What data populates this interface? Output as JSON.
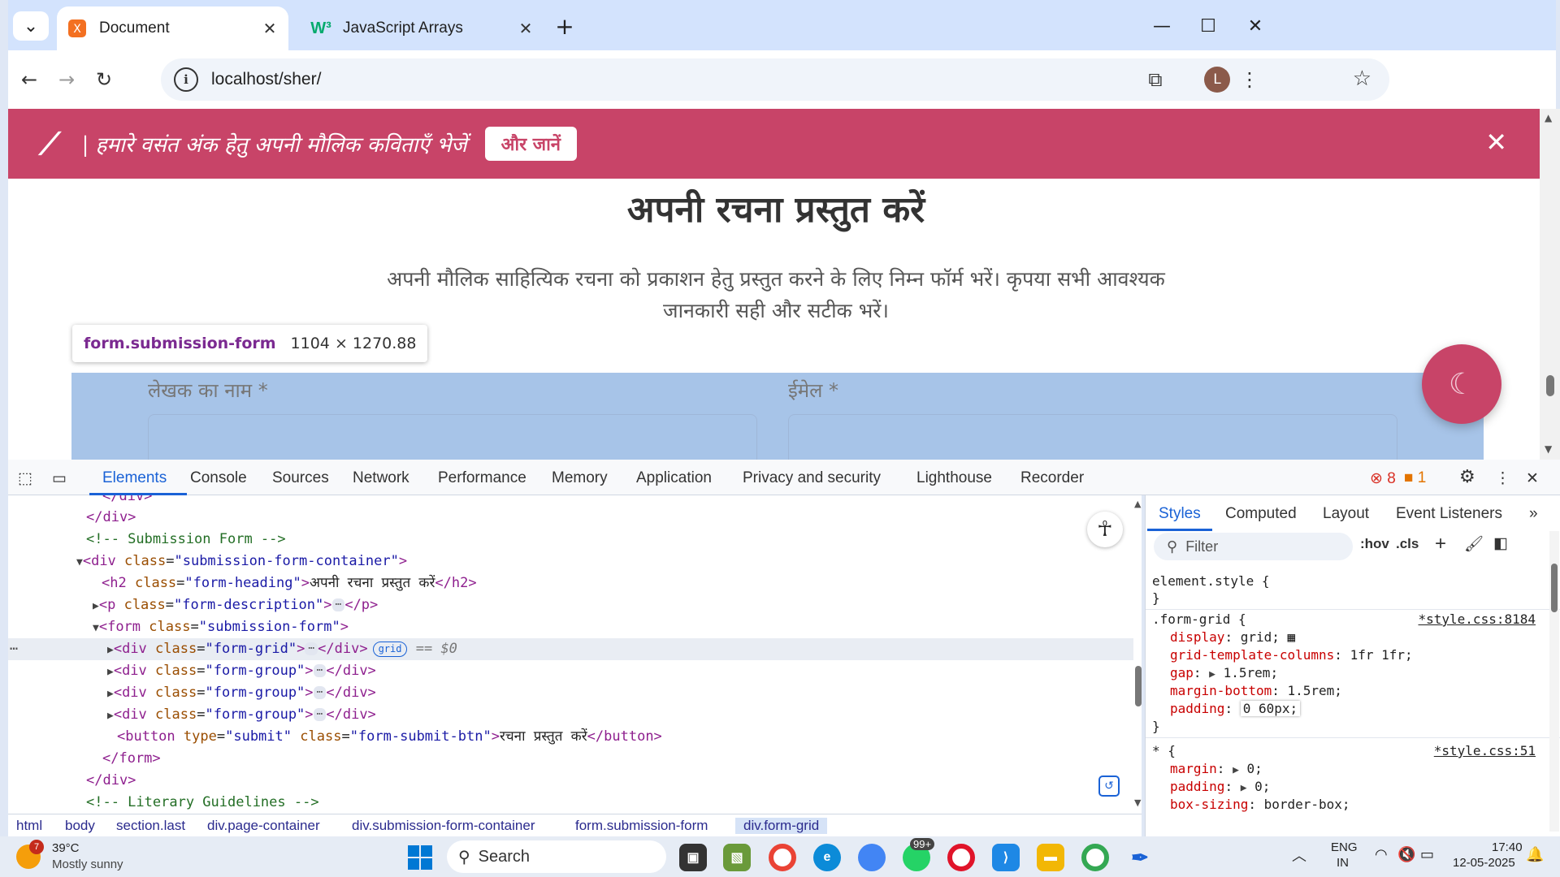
{
  "browser": {
    "tabs": [
      {
        "title": "Document",
        "close": "✕"
      },
      {
        "title": "JavaScript Arrays",
        "close": "✕"
      }
    ],
    "new_tab": "+",
    "url": "localhost/sher/",
    "profile_initial": "L"
  },
  "page": {
    "banner_text": "| हमारे वसंत अंक हेतु अपनी मौलिक कविताएँ भेजें",
    "banner_cta": "और जानें",
    "heading": "अपनी रचना प्रस्तुत करें",
    "description": "अपनी मौलिक साहित्यिक रचना को प्रकाशन हेतु प्रस्तुत करने के लिए निम्न फॉर्म भरें। कृपया सभी आवश्यक जानकारी सही और सटीक भरें।",
    "tooltip_selector": "form.submission-form",
    "tooltip_size": "1104 × 1270.88",
    "label_author": "लेखक का नाम *",
    "label_email": "ईमेल *"
  },
  "devtools": {
    "tabs": [
      "Elements",
      "Console",
      "Sources",
      "Network",
      "Performance",
      "Memory",
      "Application",
      "Privacy and security",
      "Lighthouse",
      "Recorder"
    ],
    "errors": "8",
    "warnings": "1",
    "dom_lines": {
      "l0": "</div>",
      "l1": "</div>",
      "l2": "<!-- Submission Form -->",
      "l3_tag": "div",
      "l3_class": "\"submission-form-container\"",
      "l4_tag": "h2",
      "l4_class": "\"form-heading\"",
      "l4_text": "अपनी रचना प्रस्तुत करें",
      "l5_tag": "p",
      "l5_class": "\"form-description\"",
      "l6_tag": "form",
      "l6_class": "\"submission-form\"",
      "l7_tag": "div",
      "l7_class": "\"form-grid\"",
      "l7_badge": "grid",
      "l7_ref": "== $0",
      "l8_class": "\"form-group\"",
      "l9_class": "\"form-group\"",
      "l10_class": "\"form-group\"",
      "l11_type": "\"submit\"",
      "l11_class": "\"form-submit-btn\"",
      "l11_text": "रचना प्रस्तुत करें",
      "l12": "</form>",
      "l13": "</div>",
      "l14": "<!-- Literary Guidelines -->"
    },
    "breadcrumbs": [
      "html",
      "body",
      "section.last",
      "div.page-container",
      "div.submission-form-container",
      "form.submission-form",
      "div.form-grid"
    ],
    "styles_tabs": [
      "Styles",
      "Computed",
      "Layout",
      "Event Listeners"
    ],
    "filter_placeholder": "Filter",
    "hov": ":hov",
    "cls": ".cls",
    "rules": {
      "element_style": "element.style {",
      "close": "}",
      "form_grid_selector": ".form-grid {",
      "form_grid_source": "*style.css:8184",
      "p1": "display",
      "v1": "grid;",
      "p2": "grid-template-columns",
      "v2": "1fr 1fr;",
      "p3": "gap",
      "v3": "1.5rem;",
      "p4": "margin-bottom",
      "v4": "1.5rem;",
      "p5": "padding",
      "v5": "0 60px;",
      "star_selector": "* {",
      "star_source": "*style.css:51",
      "p6": "margin",
      "v6": "0;",
      "p7": "padding",
      "v7": "0;",
      "p8": "box-sizing",
      "v8": "border-box;"
    }
  },
  "taskbar": {
    "weather_badge": "7",
    "temperature": "39°C",
    "condition": "Mostly sunny",
    "search": "Search",
    "lang1": "ENG",
    "lang2": "IN",
    "time": "17:40",
    "date": "12-05-2025",
    "whatsapp_badge": "99+"
  }
}
